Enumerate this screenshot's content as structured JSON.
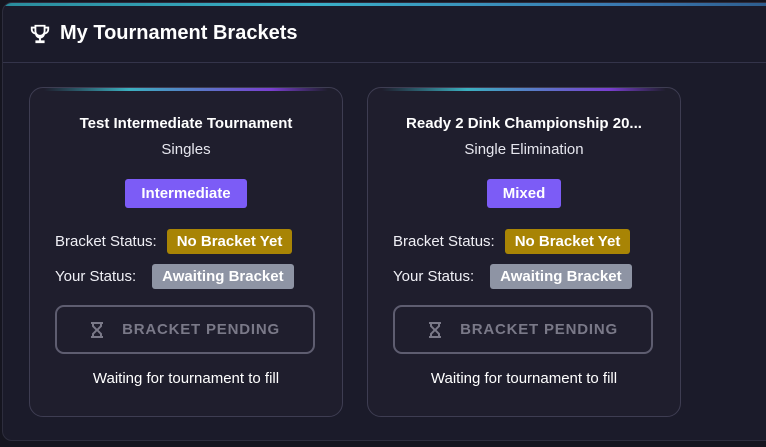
{
  "header": {
    "title": "My Tournament Brackets",
    "icon": "trophy-icon"
  },
  "colors": {
    "accent_purple": "#7c5cf6",
    "status_yellow": "#a88405",
    "status_gray": "#8e94a4",
    "background": "#1b1b2a"
  },
  "cards": [
    {
      "title": "Test Intermediate Tournament",
      "format": "Singles",
      "level": "Intermediate",
      "bracket_status_label": "Bracket Status:",
      "bracket_status": "No Bracket Yet",
      "your_status_label": "Your Status:",
      "your_status": "Awaiting Bracket",
      "button_label": "BRACKET PENDING",
      "button_icon": "hourglass-icon",
      "footer_text": "Waiting for tournament to fill"
    },
    {
      "title": "Ready 2 Dink Championship 20...",
      "format": "Single Elimination",
      "level": "Mixed",
      "bracket_status_label": "Bracket Status:",
      "bracket_status": "No Bracket Yet",
      "your_status_label": "Your Status:",
      "your_status": "Awaiting Bracket",
      "button_label": "BRACKET PENDING",
      "button_icon": "hourglass-icon",
      "footer_text": "Waiting for tournament to fill"
    }
  ]
}
